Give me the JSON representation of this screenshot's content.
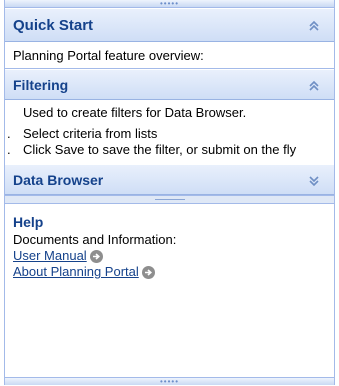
{
  "quick_start": {
    "title": "Quick Start",
    "body": "Planning Portal feature overview:"
  },
  "filtering": {
    "title": "Filtering",
    "description": "Used to create filters for Data Browser.",
    "bullets": [
      "Select criteria from lists",
      "Click Save to save the filter, or submit on the fly"
    ]
  },
  "data_browser": {
    "title": "Data Browser"
  },
  "help": {
    "title": "Help",
    "subtitle": "Documents and Information:",
    "links": [
      {
        "label": "User Manual"
      },
      {
        "label": "About Planning Portal"
      }
    ]
  },
  "icons": {
    "collapse": "double-chevron-up-icon",
    "expand": "double-chevron-down-icon",
    "link_arrow": "arrow-right-circle-icon"
  },
  "colors": {
    "header_text": "#15428b",
    "header_bg_top": "#e9f0fc",
    "header_bg_bottom": "#cfdef6",
    "border": "#a3bae9"
  }
}
